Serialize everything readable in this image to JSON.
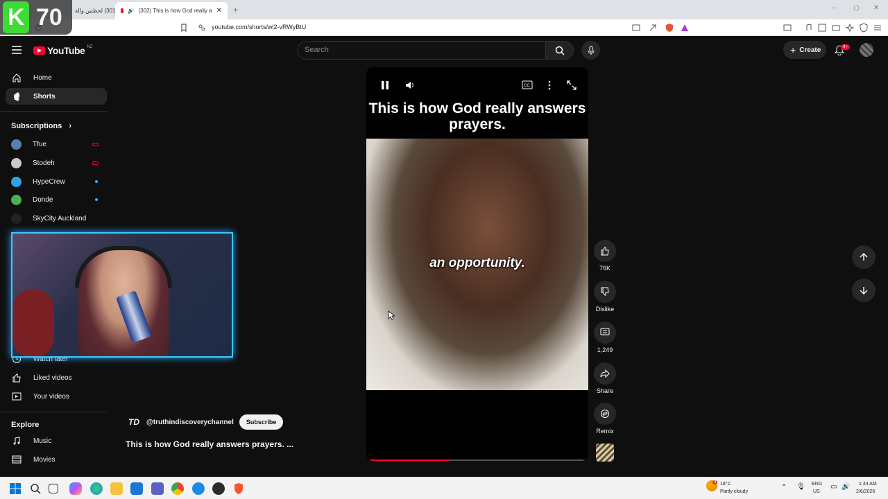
{
  "browser": {
    "tabs": [
      {
        "title": "(301) لحظتين والة"
      },
      {
        "title": "(302) This is how God really a"
      }
    ],
    "url": "youtube.com/shorts/wl2-vRWyBtU"
  },
  "overlay_badge": {
    "letter": "K",
    "number": "70"
  },
  "header": {
    "logo_text": "YouTube",
    "region": "NZ",
    "search_placeholder": "Search",
    "create_label": "Create",
    "notification_count": "9+"
  },
  "sidebar": {
    "main": [
      {
        "label": "Home",
        "icon": "home-icon"
      },
      {
        "label": "Shorts",
        "icon": "shorts-icon"
      }
    ],
    "subscriptions_label": "Subscriptions",
    "subscriptions": [
      {
        "name": "Tfue",
        "status": "live",
        "avatar_color": "#5a7fb0"
      },
      {
        "name": "Stodeh",
        "status": "live",
        "avatar_color": "#c9c9c9"
      },
      {
        "name": "HypeCrew",
        "status": "new",
        "avatar_color": "#2fa3e6"
      },
      {
        "name": "Donde",
        "status": "new",
        "avatar_color": "#4caf50"
      },
      {
        "name": "SkyCity Auckland",
        "status": "",
        "avatar_color": "#222222"
      }
    ],
    "you_items": [
      {
        "label": "Watch later",
        "icon": "clock-icon"
      },
      {
        "label": "Liked videos",
        "icon": "thumb-up-icon"
      },
      {
        "label": "Your videos",
        "icon": "video-icon"
      }
    ],
    "explore_label": "Explore",
    "explore_items": [
      {
        "label": "Music",
        "icon": "music-icon"
      },
      {
        "label": "Movies",
        "icon": "film-icon"
      }
    ]
  },
  "video": {
    "title_caption": "This is how God really answers prayers.",
    "subtitle_caption": "an opportunity.",
    "progress_fraction": 0.37,
    "channel_initials": "TD",
    "channel_handle": "@truthindiscoverychannel",
    "subscribe_label": "Subscribe",
    "description": "This is how God really answers prayers. ..."
  },
  "actions": {
    "likes": "76K",
    "dislike_label": "Dislike",
    "comments": "1,249",
    "share_label": "Share",
    "remix_label": "Remix"
  },
  "taskbar": {
    "weather_temp": "18°C",
    "weather_desc": "Partly cloudy",
    "weather_badge": "3",
    "lang_line1": "ENG",
    "lang_line2": "US",
    "time": "1:44 AM",
    "date": "2/6/2026"
  },
  "colors": {
    "yt_red": "#ff0033",
    "webcam_glow": "#3cc8ff",
    "badge_green": "#3ddc35"
  }
}
